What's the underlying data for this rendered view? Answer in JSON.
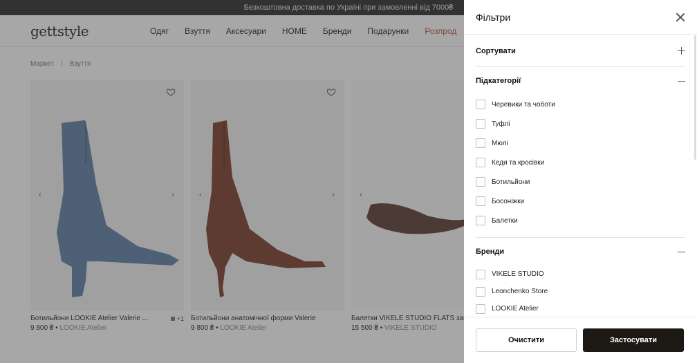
{
  "promo": "Безкоштовна доставка по Україні при замовленні від 7000₴",
  "logo": "gettstyle",
  "nav": [
    "Одяг",
    "Взуття",
    "Аксесуари",
    "HOME",
    "Бренди",
    "Подарунки",
    "Розпрод"
  ],
  "breadcrumb": [
    "Маркет",
    "/",
    "Взуття"
  ],
  "products": [
    {
      "title": "Ботильйони LOOKIE Atelier Valerie ...",
      "swatch_count": "+1",
      "price": "9 800 ₴",
      "brand": "LOOKIE Atelier",
      "color": "#5b7fa4"
    },
    {
      "title": "Ботильйони анатомічної форми Valerie",
      "price": "9 800 ₴",
      "brand": "LOOKIE Atelier",
      "color": "#7a3b28"
    },
    {
      "title": "Балетки VIKELE STUDIO FLATS замш",
      "price": "15 500 ₴",
      "brand": "VIKELE STUDIO",
      "color": "#5a3a2e"
    }
  ],
  "filters": {
    "title": "Фільтри",
    "sort_label": "Сортувати",
    "subcat_label": "Підкатегорії",
    "subcategories": [
      "Черевики та чоботи",
      "Туфлі",
      "Мюлі",
      "Кеди та кросівки",
      "Ботильйони",
      "Босоніжки",
      "Балетки"
    ],
    "brands_label": "Бренди",
    "brands": [
      "VIKELE STUDIO",
      "Leonchenko Store",
      "LOOKIE Atelier"
    ],
    "clear_label": "Очистити",
    "apply_label": "Застосувати"
  }
}
